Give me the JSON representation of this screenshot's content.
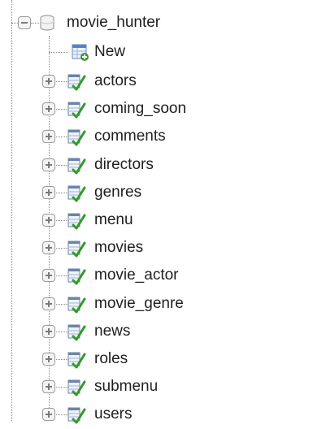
{
  "tree": {
    "database": {
      "name": "movie_hunter",
      "icon": "database-icon",
      "expanded": true
    },
    "new_item": {
      "label": "New",
      "icon": "new-table-icon"
    },
    "tables": [
      {
        "label": "actors",
        "icon": "table-icon"
      },
      {
        "label": "coming_soon",
        "icon": "table-icon"
      },
      {
        "label": "comments",
        "icon": "table-icon"
      },
      {
        "label": "directors",
        "icon": "table-icon"
      },
      {
        "label": "genres",
        "icon": "table-icon"
      },
      {
        "label": "menu",
        "icon": "table-icon"
      },
      {
        "label": "movies",
        "icon": "table-icon"
      },
      {
        "label": "movie_actor",
        "icon": "table-icon"
      },
      {
        "label": "movie_genre",
        "icon": "table-icon"
      },
      {
        "label": "news",
        "icon": "table-icon"
      },
      {
        "label": "roles",
        "icon": "table-icon"
      },
      {
        "label": "submenu",
        "icon": "table-icon"
      },
      {
        "label": "users",
        "icon": "table-icon"
      }
    ]
  }
}
